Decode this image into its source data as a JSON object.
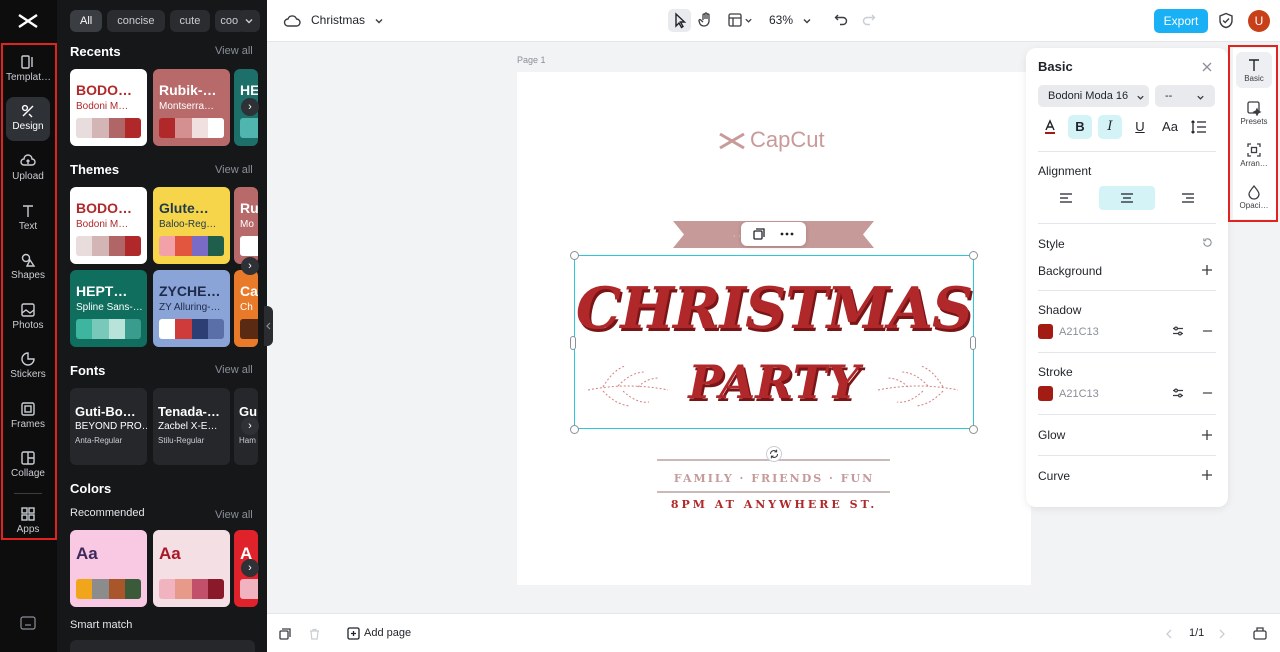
{
  "app": {
    "document_title": "Christmas",
    "zoom": "63%",
    "export_label": "Export",
    "avatar_initial": "U",
    "accent_color": "#1ab0f5"
  },
  "rail": {
    "items": [
      {
        "label": "Templat…",
        "icon": "template-icon"
      },
      {
        "label": "Design",
        "icon": "design-icon"
      },
      {
        "label": "Upload",
        "icon": "upload-icon"
      },
      {
        "label": "Text",
        "icon": "text-icon"
      },
      {
        "label": "Shapes",
        "icon": "shapes-icon"
      },
      {
        "label": "Photos",
        "icon": "photos-icon"
      },
      {
        "label": "Stickers",
        "icon": "stickers-icon"
      },
      {
        "label": "Frames",
        "icon": "frames-icon"
      },
      {
        "label": "Collage",
        "icon": "collage-icon"
      },
      {
        "label": "Apps",
        "icon": "apps-icon"
      }
    ],
    "active": "Design"
  },
  "panel": {
    "chips": [
      "All",
      "concise",
      "cute",
      "coo"
    ],
    "sections": {
      "recents": "Recents",
      "themes": "Themes",
      "fonts": "Fonts",
      "colors": "Colors",
      "recommended": "Recommended",
      "smart_match": "Smart match"
    },
    "view_all": "View all",
    "recents": [
      {
        "t1": "BODO…",
        "t2": "Bodoni M…",
        "bg": "#ffffff",
        "c1": "#b0282a",
        "c2": "#b0282a",
        "swatches": [
          "#e8dcdc",
          "#d4b5b5",
          "#b06666",
          "#b0282a"
        ]
      },
      {
        "t1": "Rubik-…",
        "t2": "Montserra…",
        "bg": "#b86a6a",
        "c1": "#ffffff",
        "c2": "#ffffff",
        "swatches": [
          "#b0282a",
          "#d49090",
          "#f0e0e0",
          "#ffffff"
        ]
      },
      {
        "t1": "HE",
        "t2": "",
        "bg": "#1d6f6a",
        "c1": "#ffffff",
        "c2": "#ffffff",
        "swatches": [
          "#4fb5ae",
          "#8fd3cf"
        ]
      }
    ],
    "themes": [
      {
        "t1": "BODO…",
        "t2": "Bodoni M…",
        "bg": "#ffffff",
        "c1": "#b0282a",
        "c2": "#b0282a",
        "swatches": [
          "#e8dcdc",
          "#d4b5b5",
          "#b06666",
          "#b0282a"
        ]
      },
      {
        "t1": "Glute…",
        "t2": "Baloo-Reg…",
        "bg": "#f7d54a",
        "c1": "#1f3a4a",
        "c2": "#1f3a4a",
        "swatches": [
          "#f2a1a8",
          "#e2563f",
          "#7a6cc6",
          "#1f5e4a"
        ]
      },
      {
        "t1": "Ru",
        "t2": "Mo",
        "bg": "#b86a6a",
        "c1": "#ffffff",
        "c2": "#ffffff",
        "swatches": [
          "#ffffff",
          "#f0e0e0"
        ]
      },
      {
        "t1": "HEPT…",
        "t2": "Spline Sans-…",
        "bg": "#0f6e5e",
        "c1": "#ffffff",
        "c2": "#ffffff",
        "swatches": [
          "#3db59f",
          "#79c9bb",
          "#b8e3db",
          "#3a9c8c"
        ]
      },
      {
        "t1": "ZYCHE…",
        "t2": "ZY Alluring-…",
        "bg": "#8aa4d8",
        "c1": "#1f2a4a",
        "c2": "#1f2a4a",
        "swatches": [
          "#ffffff",
          "#cf3a3a",
          "#2c3e74",
          "#5a6fa8"
        ]
      },
      {
        "t1": "Ca",
        "t2": "Ch",
        "bg": "#e87a2a",
        "c1": "#ffffff",
        "c2": "#ffffff",
        "swatches": [
          "#5a2a12",
          "#9a4a1a"
        ]
      }
    ],
    "fonts": [
      {
        "f1": "Guti-Bo…",
        "f2": "BEYOND PRO…",
        "f3": "Anta-Regular"
      },
      {
        "f1": "Tenada-…",
        "f2": "Zacbel X-E…",
        "f3": "Stilu-Regular"
      },
      {
        "f1": "Gu",
        "f2": "",
        "f3": "Ham"
      }
    ],
    "colors": [
      {
        "aa": "Aa",
        "bg": "#f9c9e4",
        "fg": "#3d2a5a",
        "swatches": [
          "#f0a51a",
          "#8c8c8c",
          "#a8562a",
          "#3a5a3a"
        ]
      },
      {
        "aa": "Aa",
        "bg": "#f4e0e4",
        "fg": "#a8182a",
        "swatches": [
          "#f2b3c0",
          "#e89a8a",
          "#c2506a",
          "#8a1a2a"
        ]
      },
      {
        "aa": "A",
        "bg": "#e0222a",
        "fg": "#ffffff",
        "swatches": [
          "#f2b3c0"
        ]
      }
    ]
  },
  "canvas": {
    "page_label": "Page 1",
    "logo_text": "CapCut",
    "title": "CHRISTMAS",
    "subtitle": "PARTY",
    "tagline": "FAMILY · FRIENDS · FUN",
    "time": "8PM AT ANYWHERE ST."
  },
  "props": {
    "title": "Basic",
    "font_name": "Bodoni Moda 16",
    "font_size": "--",
    "format": {
      "bold": "B",
      "italic": "I",
      "underline": "U",
      "case": "Aa"
    },
    "alignment_label": "Alignment",
    "style_label": "Style",
    "background_label": "Background",
    "shadow_label": "Shadow",
    "shadow_color": "A21C13",
    "stroke_label": "Stroke",
    "stroke_color": "A21C13",
    "glow_label": "Glow",
    "curve_label": "Curve"
  },
  "right_rail": {
    "items": [
      {
        "label": "Basic",
        "icon": "text-icon"
      },
      {
        "label": "Presets",
        "icon": "presets-icon"
      },
      {
        "label": "Arran…",
        "icon": "arrange-icon"
      },
      {
        "label": "Opaci…",
        "icon": "opacity-icon"
      }
    ]
  },
  "bottom": {
    "add_page": "Add page",
    "page_count": "1/1"
  }
}
